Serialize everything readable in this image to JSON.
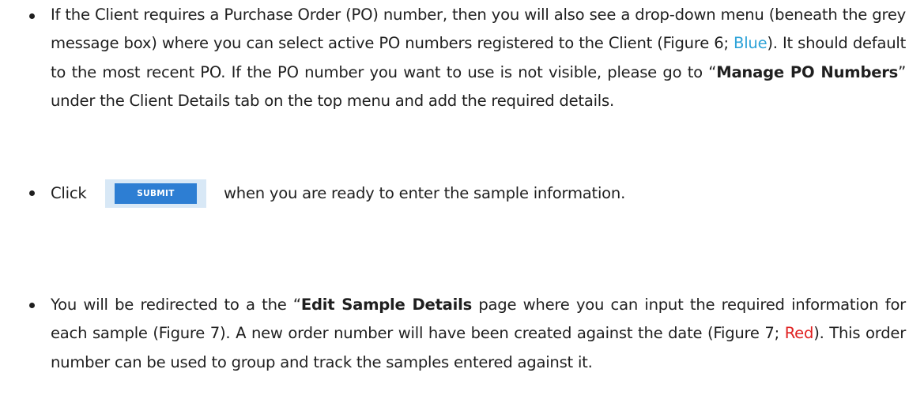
{
  "bullets": [
    {
      "segments": [
        {
          "text": "If the Client requires a Purchase Order (PO) number, then you will also see a drop-down menu (beneath the grey message box) where you can select active PO numbers registered to the Client (Figure 6; ",
          "style": "normal"
        },
        {
          "text": "Blue",
          "style": "blue"
        },
        {
          "text": "). It should default to the most recent PO. If the PO number you want to use is not visible, please go to “",
          "style": "normal"
        },
        {
          "text": "Manage PO Numbers",
          "style": "strong"
        },
        {
          "text": "” under the Client Details tab on the top menu and add the required details.",
          "style": "normal"
        }
      ]
    },
    {
      "click_label": "Click",
      "submit_button_label": "SUBMIT",
      "after_text": "when you are ready to enter the sample information."
    },
    {
      "segments": [
        {
          "text": "You will be redirected to a the “",
          "style": "normal"
        },
        {
          "text": "Edit Sample Details",
          "style": "strong"
        },
        {
          "text": " page where you can input the required information for each sample (Figure 7). A new order number will have been created against the date (Figure 7; ",
          "style": "normal"
        },
        {
          "text": "Red",
          "style": "red"
        },
        {
          "text": "). This order number can be used to group and track the samples entered against it.",
          "style": "normal"
        }
      ]
    }
  ],
  "colors": {
    "blue_highlight": "#2ea3d8",
    "red_highlight": "#e02020",
    "submit_button": "#2d7ed3"
  }
}
